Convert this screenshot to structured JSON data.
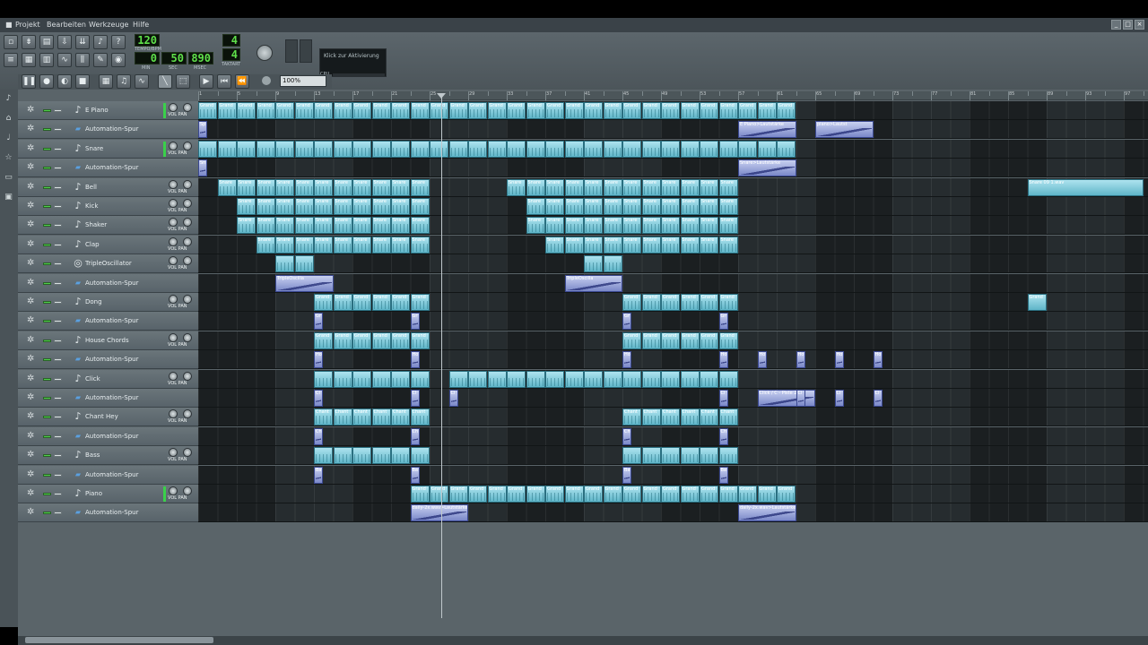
{
  "menu": {
    "items": [
      "Projekt",
      "Bearbeiten",
      "Werkzeuge",
      "Hilfe"
    ]
  },
  "transport": {
    "tempo_value": "120",
    "tempo_label": "TEMPO/BPM",
    "time_min": "0",
    "time_sec": "50",
    "time_msec": "890",
    "min_label": "MIN",
    "sec_label": "SEC",
    "msec_label": "MSEC",
    "timesig_num": "4",
    "timesig_den": "4",
    "timesig_label": "TAKTART",
    "cpu_text": "Klick zur Aktivierung",
    "cpu_label": "CPU"
  },
  "zoom": {
    "value": "100%"
  },
  "ruler": {
    "bars": [
      "1",
      "5",
      "9",
      "13",
      "17",
      "21",
      "25",
      "29",
      "33",
      "37",
      "41",
      "45",
      "49",
      "53",
      "57",
      "61",
      "65",
      "69",
      "73",
      "77",
      "81",
      "85",
      "89",
      "93",
      "97",
      "101",
      "105",
      "109",
      "113",
      "117",
      "121",
      "125"
    ]
  },
  "tracks": [
    {
      "name": "E Piano",
      "type": "instrument",
      "clips_label": "Grand",
      "segments": [
        [
          0,
          31
        ]
      ],
      "color_bar": true
    },
    {
      "name": "Automation-Spur",
      "type": "automation",
      "labels": [
        "Sp",
        "Sp",
        "piano>Lautst",
        "E Piano>Lautstärke"
      ]
    },
    {
      "name": "Snare",
      "type": "instrument",
      "clips_label": "",
      "segments": [
        [
          0,
          31
        ]
      ],
      "color_bar": true
    },
    {
      "name": "Automation-Spur",
      "type": "automation",
      "labels": [
        "Sn",
        "Snare>Lautstärke"
      ]
    },
    {
      "name": "Bell",
      "type": "instrument",
      "clips_label": "Snare",
      "segments": [
        [
          1,
          12
        ],
        [
          16,
          28
        ]
      ],
      "extra_label": "Snare 09 1.wav"
    },
    {
      "name": "Kick",
      "type": "instrument",
      "clips_label": "Snare",
      "segments": [
        [
          2,
          12
        ],
        [
          17,
          28
        ]
      ]
    },
    {
      "name": "Shaker",
      "type": "instrument",
      "clips_label": "Snare",
      "segments": [
        [
          2,
          12
        ],
        [
          17,
          28
        ]
      ]
    },
    {
      "name": "Clap",
      "type": "instrument",
      "clips_label": "Snare",
      "segments": [
        [
          3,
          12
        ],
        [
          18,
          28
        ]
      ]
    },
    {
      "name": "TripleOscillator",
      "type": "triple",
      "clips_label": "",
      "segments": [
        [
          4,
          6
        ],
        [
          20,
          22
        ]
      ]
    },
    {
      "name": "Automation-Spur",
      "type": "automation",
      "labels": [
        "TripleOscilla",
        "TripleOscilla"
      ]
    },
    {
      "name": "Dong",
      "type": "instrument",
      "clips_label": "Grand",
      "segments": [
        [
          6,
          12
        ],
        [
          22,
          28
        ]
      ],
      "extra_label": "Grand"
    },
    {
      "name": "Automation-Spur",
      "type": "automation",
      "labels": [
        "Gr",
        "Gr",
        "Gr",
        "Gr"
      ]
    },
    {
      "name": "House Chords",
      "type": "instrument",
      "clips_label": "Grand",
      "segments": [
        [
          6,
          12
        ],
        [
          22,
          28
        ]
      ]
    },
    {
      "name": "Automation-Spur",
      "type": "automation",
      "labels": [
        "Ho",
        "Ho",
        "Ho",
        "Ho",
        "Ho",
        "Ho",
        "Ho",
        "Ho"
      ]
    },
    {
      "name": "Click",
      "type": "instrument",
      "clips_label": "",
      "segments": [
        [
          6,
          12
        ],
        [
          13,
          28
        ]
      ]
    },
    {
      "name": "Automation-Spur",
      "type": "automation",
      "labels": [
        "Cl",
        "Cl",
        "Cl",
        "Cl",
        "Click / C - Piste 2K2",
        "Cl",
        "Cl",
        "Cl"
      ]
    },
    {
      "name": "Chant Hey",
      "type": "instrument",
      "clips_label": "Chant",
      "segments": [
        [
          6,
          12
        ],
        [
          22,
          28
        ]
      ]
    },
    {
      "name": "Automation-Spur",
      "type": "automation",
      "labels": [
        "Ch",
        "Ch",
        "Ch",
        "Ch"
      ]
    },
    {
      "name": "Bass",
      "type": "instrument",
      "clips_label": "",
      "segments": [
        [
          6,
          12
        ],
        [
          22,
          28
        ]
      ]
    },
    {
      "name": "Automation-Spur",
      "type": "automation",
      "labels": [
        "Ba",
        "Ba",
        "Ba",
        "Ba"
      ]
    },
    {
      "name": "Piano",
      "type": "instrument",
      "clips_label": "Grand",
      "segments": [
        [
          11,
          31
        ]
      ],
      "color_bar": true
    },
    {
      "name": "Automation-Spur",
      "type": "automation",
      "labels": [
        "daily-2x.wav>Lautstärke",
        "Pi",
        "daily-2x.wav>Lautstärke"
      ]
    }
  ],
  "knob_labels": {
    "vol": "VOL",
    "pan": "PAN"
  },
  "icons": {
    "gear": "gear-icon",
    "instrument": "note-icon",
    "automation": "automation-icon"
  }
}
